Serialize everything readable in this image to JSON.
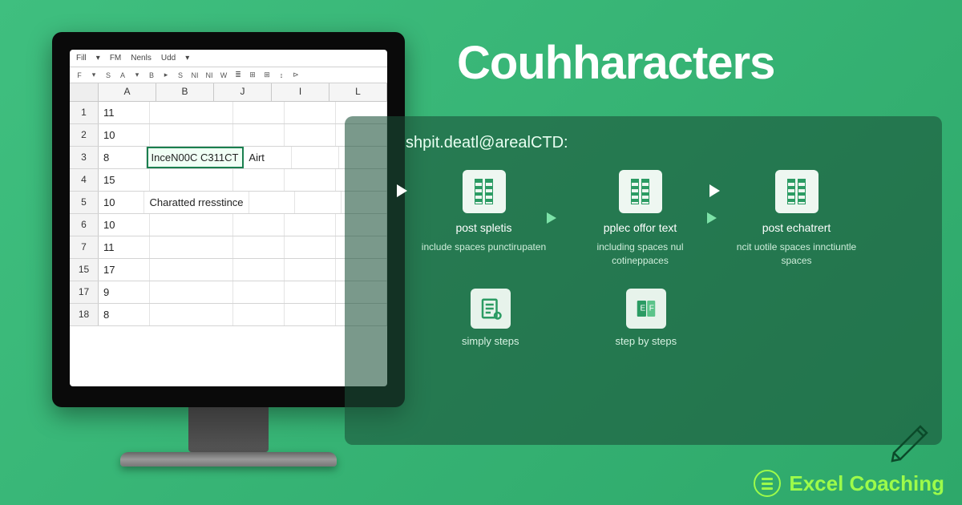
{
  "title": "Couhharacters",
  "panel_heading": "shpit.deatl@arealCTD:",
  "menubar": [
    "Fill",
    "FM",
    "Nenls",
    "Udd"
  ],
  "toolbar": [
    "F",
    "S",
    "A",
    "▸",
    "B",
    "▸",
    "S",
    "NI",
    "NI",
    "W",
    "≣",
    "⊞",
    "⊞",
    "↕",
    "⊳"
  ],
  "columns": [
    "A",
    "B",
    "J",
    "I",
    "L"
  ],
  "rows": [
    {
      "n": "1",
      "A": "11",
      "B": "",
      "J": "",
      "I": "",
      "L": ""
    },
    {
      "n": "2",
      "A": "10",
      "B": "",
      "J": "",
      "I": "",
      "L": ""
    },
    {
      "n": "3",
      "A": "8",
      "B": "InceN00C C311CT",
      "J": "Airt",
      "I": "",
      "L": "",
      "sel": true
    },
    {
      "n": "4",
      "A": "15",
      "B": "",
      "J": "",
      "I": "",
      "L": ""
    },
    {
      "n": "5",
      "A": "10",
      "B": "Charatted rresstince",
      "J": "",
      "I": "",
      "L": ""
    },
    {
      "n": "6",
      "A": "10",
      "B": "",
      "J": "",
      "I": "",
      "L": ""
    },
    {
      "n": "7",
      "A": "11",
      "B": "",
      "J": "",
      "I": "",
      "L": ""
    },
    {
      "n": "15",
      "A": "17",
      "B": "",
      "J": "",
      "I": "",
      "L": ""
    },
    {
      "n": "17",
      "A": "9",
      "B": "",
      "J": "",
      "I": "",
      "L": ""
    },
    {
      "n": "18",
      "A": "8",
      "B": "",
      "J": "",
      "I": "",
      "L": ""
    }
  ],
  "steps": [
    {
      "title": "post spletis",
      "sub": "include spaces punctirupaten"
    },
    {
      "title": "pplec offor text",
      "sub": "including spaces nul cotineppaces"
    },
    {
      "title": "post echatrert",
      "sub": "ncit uotile spaces innctiuntle spaces"
    }
  ],
  "bottom_steps": [
    {
      "label": "simply steps"
    },
    {
      "label": "step by steps"
    }
  ],
  "brand": "Excel Coaching"
}
